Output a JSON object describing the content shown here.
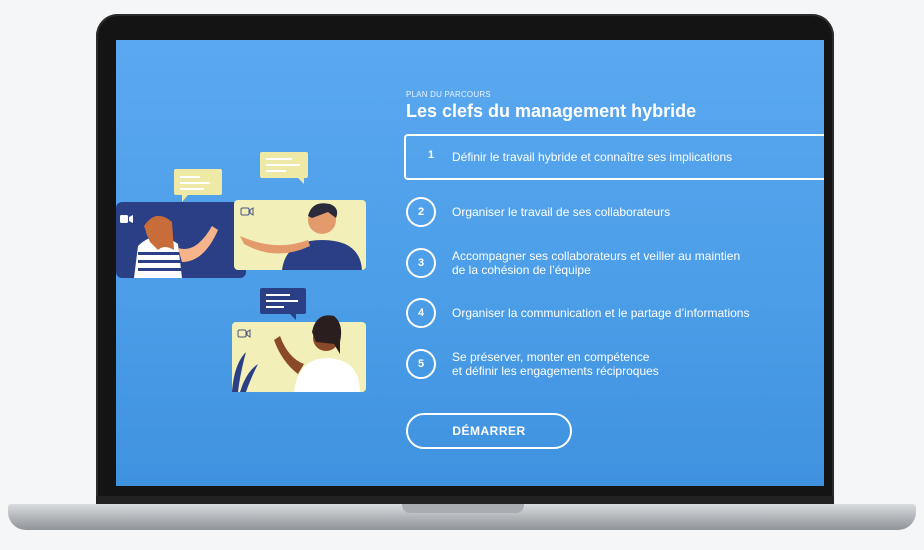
{
  "course": {
    "kicker": "PLAN DU PARCOURS",
    "title": "Les clefs du management hybride"
  },
  "steps": [
    {
      "number": "1",
      "label": "Définir le travail hybride et connaître ses implications",
      "active": true
    },
    {
      "number": "2",
      "label": "Organiser le travail de ses collaborateurs",
      "active": false
    },
    {
      "number": "3",
      "label_line1": "Accompagner ses collaborateurs et veiller au maintien",
      "label_line2": "de la cohésion de l’équipe",
      "active": false
    },
    {
      "number": "4",
      "label": "Organiser la communication et le partage d’informations",
      "active": false
    },
    {
      "number": "5",
      "label_line1": "Se préserver, monter en compétence",
      "label_line2": "et définir les engagements réciproques",
      "active": false
    }
  ],
  "cta": {
    "label": "DÉMARRER"
  },
  "colors": {
    "screen_bg": "#4c9ee8",
    "navy_panel": "#2b3f86",
    "yellow_panel": "#f2efb8",
    "bubble": "#eee9a5",
    "white": "#ffffff"
  },
  "icons": [
    "video-camera-icon",
    "chat-bubble-icon"
  ]
}
